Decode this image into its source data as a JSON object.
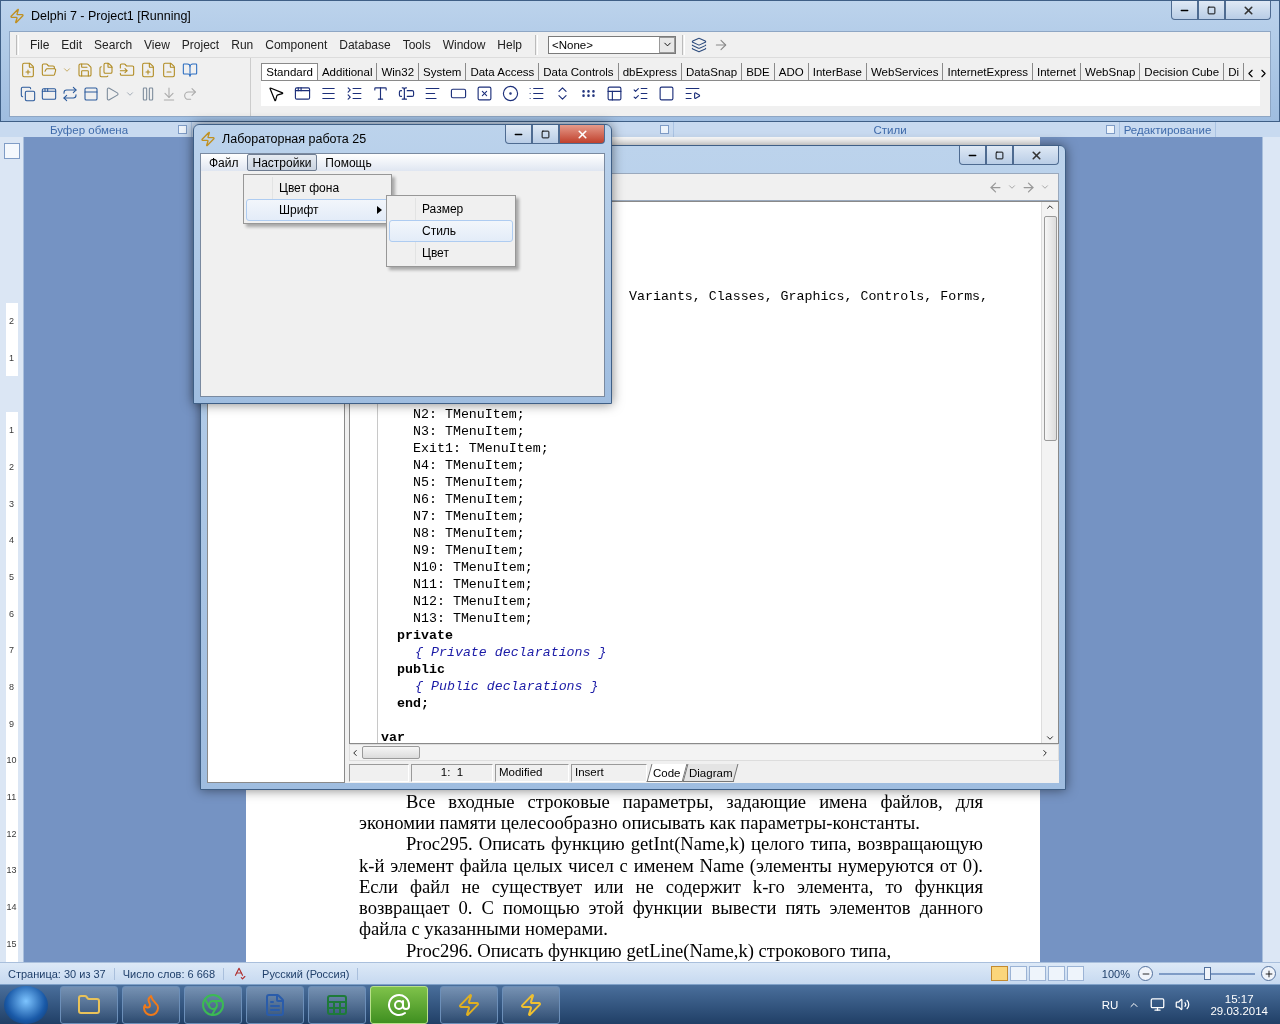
{
  "delphi": {
    "title": "Delphi 7 - Project1 [Running]",
    "menu": [
      "File",
      "Edit",
      "Search",
      "View",
      "Project",
      "Run",
      "Component",
      "Database",
      "Tools",
      "Window",
      "Help"
    ],
    "config_combo": "<None>",
    "palette_tabs": [
      {
        "label": "Standard",
        "selected": true
      },
      {
        "label": "Additional",
        "selected": false
      },
      {
        "label": "Win32",
        "selected": false
      },
      {
        "label": "System",
        "selected": false
      },
      {
        "label": "Data Access",
        "selected": false
      },
      {
        "label": "Data Controls",
        "selected": false
      },
      {
        "label": "dbExpress",
        "selected": false
      },
      {
        "label": "DataSnap",
        "selected": false
      },
      {
        "label": "BDE",
        "selected": false
      },
      {
        "label": "ADO",
        "selected": false
      },
      {
        "label": "InterBase",
        "selected": false
      },
      {
        "label": "WebServices",
        "selected": false
      },
      {
        "label": "InternetExpress",
        "selected": false
      },
      {
        "label": "Internet",
        "selected": false
      },
      {
        "label": "WebSnap",
        "selected": false
      },
      {
        "label": "Decision Cube",
        "selected": false
      },
      {
        "label": "Di",
        "selected": false
      }
    ]
  },
  "word": {
    "ribbon_groups": [
      "Буфер обмена",
      "Стили",
      "Редактирование"
    ],
    "ruler_labels": [
      "2",
      "1",
      "1",
      "2",
      "3",
      "4",
      "5",
      "6",
      "7",
      "8",
      "9",
      "10",
      "11",
      "12",
      "13",
      "14",
      "15"
    ],
    "document": {
      "paragraphs": [
        "Все входные строковые параметры, задающие имена файлов, для экономии памяти целесообразно описывать как параметры-константы.",
        "Proc295. Описать функцию getInt(Name,k) целого типа, возвращающую k-й элемент файла целых чисел с именем Name (элементы нумеруются от 0). Если файл не существует или не содержит k-го элемента, то функция возвращает 0. С помощью этой функции вывести пять элементов данного файла с указанными номерами.",
        "Proc296. Описать функцию getLine(Name,k) строкового типа,"
      ]
    },
    "status_bar": {
      "page": "Страница: 30 из 37",
      "words": "Число слов: 6 668",
      "language": "Русский (Россия)",
      "view_buttons": [
        {
          "selected": true
        },
        {
          "selected": false
        },
        {
          "selected": false
        },
        {
          "selected": false
        },
        {
          "selected": false
        }
      ],
      "zoom": "100%",
      "zoom_slider": {
        "level": 0.5
      }
    }
  },
  "code_editor": {
    "lines": [
      {
        "text": "Variants, Classes, Graphics, Controls, Forms,",
        "kind": "continuation"
      },
      {
        "text": "N2: TMenuItem;",
        "kind": "field"
      },
      {
        "text": "N3: TMenuItem;",
        "kind": "field"
      },
      {
        "text": "Exit1: TMenuItem;",
        "kind": "field"
      },
      {
        "text": "N4: TMenuItem;",
        "kind": "field"
      },
      {
        "text": "N5: TMenuItem;",
        "kind": "field"
      },
      {
        "text": "N6: TMenuItem;",
        "kind": "field"
      },
      {
        "text": "N7: TMenuItem;",
        "kind": "field"
      },
      {
        "text": "N8: TMenuItem;",
        "kind": "field"
      },
      {
        "text": "N9: TMenuItem;",
        "kind": "field"
      },
      {
        "text": "N10: TMenuItem;",
        "kind": "field"
      },
      {
        "text": "N11: TMenuItem;",
        "kind": "field"
      },
      {
        "text": "N12: TMenuItem;",
        "kind": "field"
      },
      {
        "text": "N13: TMenuItem;",
        "kind": "field"
      },
      {
        "text": "private",
        "kind": "section"
      },
      {
        "text": "{ Private declarations }",
        "kind": "comment"
      },
      {
        "text": "public",
        "kind": "section"
      },
      {
        "text": "{ Public declarations }",
        "kind": "comment"
      },
      {
        "text": "end;",
        "kind": "section"
      },
      {
        "text": "var",
        "kind": "top"
      }
    ],
    "status": {
      "position": "1:  1",
      "modified": "Modified",
      "mode": "Insert"
    },
    "tabs": [
      {
        "label": "Code",
        "selected": true
      },
      {
        "label": "Diagram",
        "selected": false
      }
    ]
  },
  "form": {
    "title": "Лабораторная работа 25",
    "menu": [
      {
        "label": "Файл",
        "selected": false
      },
      {
        "label": "Настройки",
        "selected": true
      },
      {
        "label": "Помощь",
        "selected": false
      }
    ],
    "dropdown": [
      {
        "label": "Цвет фона",
        "selected": false,
        "has_submenu": false
      },
      {
        "label": "Шрифт",
        "selected": true,
        "has_submenu": true
      }
    ],
    "submenu": [
      {
        "label": "Размер",
        "selected": false
      },
      {
        "label": "Стиль",
        "selected": true
      },
      {
        "label": "Цвет",
        "selected": false
      }
    ]
  },
  "taskbar": {
    "buttons": [
      {
        "kind": "explorer",
        "active": false
      },
      {
        "kind": "firefox",
        "active": false
      },
      {
        "kind": "chrome",
        "active": false
      },
      {
        "kind": "word",
        "active": false
      },
      {
        "kind": "excel",
        "active": false
      },
      {
        "kind": "mail",
        "active": true
      },
      {
        "kind": "delphi",
        "active": false
      },
      {
        "kind": "delphi-app",
        "active": false
      }
    ],
    "language": "RU",
    "time": "15:17",
    "date": "29.03.2014"
  }
}
